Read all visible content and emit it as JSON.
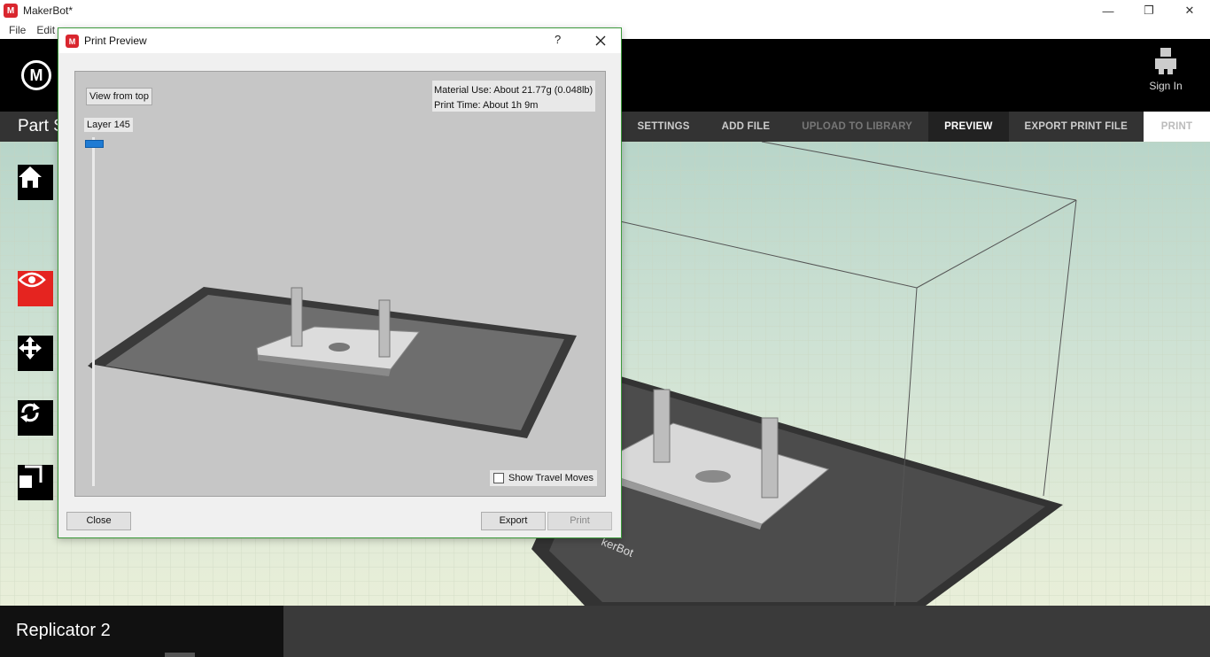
{
  "window": {
    "title": "MakerBot*",
    "logo_letter": "M",
    "minimize": "—",
    "restore": "❐",
    "close": "✕"
  },
  "menu": [
    "File",
    "Edit"
  ],
  "header": {
    "sign_in": "Sign In"
  },
  "navbar": {
    "part_title": "Part S",
    "tabs": {
      "settings": "SETTINGS",
      "add_file": "ADD FILE",
      "upload": "UPLOAD TO LIBRARY",
      "preview": "PREVIEW",
      "export": "EXPORT PRINT FILE",
      "print": "PRINT"
    }
  },
  "toolbar": {
    "icons": [
      "home-icon",
      "eye-icon",
      "move-icon",
      "rotate-icon",
      "scale-icon"
    ]
  },
  "bottom": {
    "printer": "Replicator 2"
  },
  "dialog": {
    "title": "Print Preview",
    "help": "?",
    "view_from_top": "View from top",
    "layer_label": "Layer 145",
    "layer_level": 1.0,
    "material_use": "Material Use: About 21.77g (0.048lb)",
    "print_time": "Print Time: About 1h 9m",
    "show_travel": "Show Travel Moves",
    "show_travel_checked": false,
    "close_btn": "Close",
    "export_btn": "Export",
    "print_btn": "Print"
  },
  "viewport": {
    "bed_label": "kerBot"
  },
  "colors": {
    "accent_red": "#e52420",
    "slider_blue": "#1f7bd4",
    "dialog_border": "#3c9a3c"
  }
}
